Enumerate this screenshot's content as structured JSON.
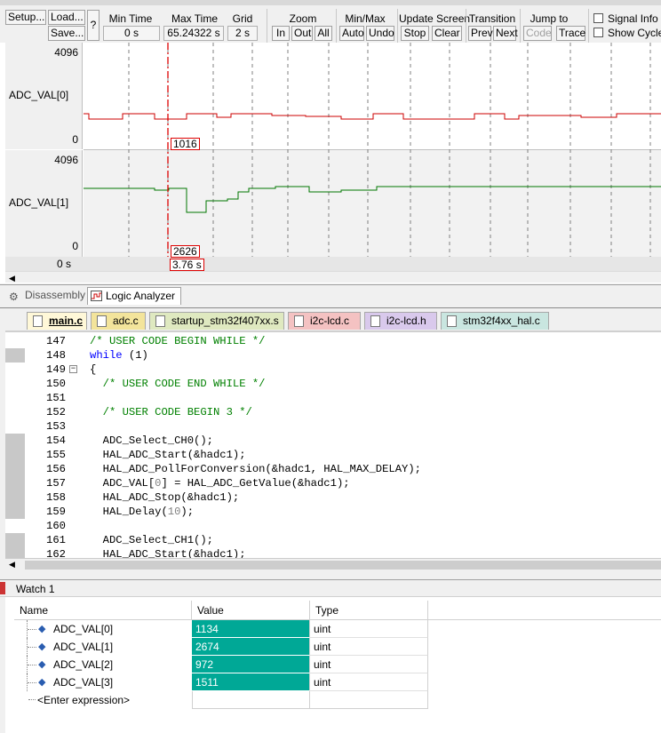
{
  "toolbar": {
    "setup": "Setup...",
    "load": "Load...",
    "save": "Save...",
    "help": "?",
    "min_time_label": "Min Time",
    "min_time_value": "0 s",
    "max_time_label": "Max Time",
    "max_time_value": "65.24322 s",
    "grid_label": "Grid",
    "grid_value": "2 s",
    "zoom_label": "Zoom",
    "zoom_in": "In",
    "zoom_out": "Out",
    "zoom_all": "All",
    "minmax_label": "Min/Max",
    "minmax_auto": "Auto",
    "minmax_undo": "Undo",
    "update_label": "Update Screen",
    "update_stop": "Stop",
    "update_clear": "Clear",
    "transition_label": "Transition",
    "transition_prev": "Prev",
    "transition_next": "Next",
    "jump_label": "Jump to",
    "jump_code": "Code",
    "jump_trace": "Trace",
    "signal_info": "Signal Info",
    "show_cycles": "Show Cycles"
  },
  "analyzer": {
    "signals": [
      {
        "name": "ADC_VAL[0]",
        "max": "4096",
        "min": "0",
        "cursor_value": "1016",
        "color": "#cc0000"
      },
      {
        "name": "ADC_VAL[1]",
        "max": "4096",
        "min": "0",
        "cursor_value": "2626",
        "color": "#007700"
      }
    ],
    "time_start": "0 s",
    "cursor_time": "3.76 s",
    "cursor_color": "#dd0000"
  },
  "bottom_tabs": [
    {
      "label": "Disassembly",
      "active": false
    },
    {
      "label": "Logic Analyzer",
      "active": true
    }
  ],
  "file_tabs": [
    {
      "label": "main.c",
      "color": "#f7f1c8",
      "active": true
    },
    {
      "label": "adc.c",
      "color": "#f3e49b",
      "active": false
    },
    {
      "label": "startup_stm32f407xx.s",
      "color": "#dfe9c0",
      "active": false
    },
    {
      "label": "i2c-lcd.c",
      "color": "#f4c2c2",
      "active": false
    },
    {
      "label": "i2c-lcd.h",
      "color": "#d9c9ec",
      "active": false
    },
    {
      "label": "stm32f4xx_hal.c",
      "color": "#c9e6e0",
      "active": false
    }
  ],
  "code": [
    {
      "ln": "147",
      "mark": false,
      "parts": [
        {
          "t": "/* USER CODE BEGIN WHILE */",
          "c": "cmt"
        }
      ]
    },
    {
      "ln": "148",
      "mark": true,
      "parts": [
        {
          "t": "while",
          "c": "kw"
        },
        {
          "t": " (1)",
          "c": ""
        }
      ]
    },
    {
      "ln": "149",
      "mark": false,
      "fold": true,
      "parts": [
        {
          "t": "{",
          "c": ""
        }
      ]
    },
    {
      "ln": "150",
      "mark": false,
      "parts": [
        {
          "t": "  /* USER CODE END WHILE */",
          "c": "cmt"
        }
      ]
    },
    {
      "ln": "151",
      "mark": false,
      "parts": []
    },
    {
      "ln": "152",
      "mark": false,
      "parts": [
        {
          "t": "  /* USER CODE BEGIN 3 */",
          "c": "cmt"
        }
      ]
    },
    {
      "ln": "153",
      "mark": false,
      "parts": []
    },
    {
      "ln": "154",
      "mark": true,
      "parts": [
        {
          "t": "  ADC_Select_CH0();",
          "c": ""
        }
      ]
    },
    {
      "ln": "155",
      "mark": true,
      "parts": [
        {
          "t": "  HAL_ADC_Start(&hadc1);",
          "c": ""
        }
      ]
    },
    {
      "ln": "156",
      "mark": true,
      "parts": [
        {
          "t": "  HAL_ADC_PollForConversion(&hadc1, HAL_MAX_DELAY);",
          "c": ""
        }
      ]
    },
    {
      "ln": "157",
      "mark": true,
      "parts": [
        {
          "t": "  ADC_VAL[",
          "c": ""
        },
        {
          "t": "0",
          "c": "num"
        },
        {
          "t": "] = HAL_ADC_GetValue(&hadc1);",
          "c": ""
        }
      ]
    },
    {
      "ln": "158",
      "mark": true,
      "parts": [
        {
          "t": "  HAL_ADC_Stop(&hadc1);",
          "c": ""
        }
      ]
    },
    {
      "ln": "159",
      "mark": true,
      "parts": [
        {
          "t": "  HAL_Delay(",
          "c": ""
        },
        {
          "t": "10",
          "c": "num"
        },
        {
          "t": ");",
          "c": ""
        }
      ]
    },
    {
      "ln": "160",
      "mark": false,
      "parts": []
    },
    {
      "ln": "161",
      "mark": true,
      "parts": [
        {
          "t": "  ADC_Select_CH1();",
          "c": ""
        }
      ]
    },
    {
      "ln": "162",
      "mark": true,
      "parts": [
        {
          "t": "  HAL_ADC_Start(&hadc1);",
          "c": ""
        }
      ]
    }
  ],
  "watch": {
    "title": "Watch 1",
    "headers": {
      "name": "Name",
      "value": "Value",
      "type": "Type"
    },
    "rows": [
      {
        "name": "ADC_VAL[0]",
        "value": "1134",
        "type": "uint"
      },
      {
        "name": "ADC_VAL[1]",
        "value": "2674",
        "type": "uint"
      },
      {
        "name": "ADC_VAL[2]",
        "value": "972",
        "type": "uint"
      },
      {
        "name": "ADC_VAL[3]",
        "value": "1511",
        "type": "uint"
      }
    ],
    "enter_expression": "<Enter expression>",
    "value_bg": "#00a896"
  }
}
